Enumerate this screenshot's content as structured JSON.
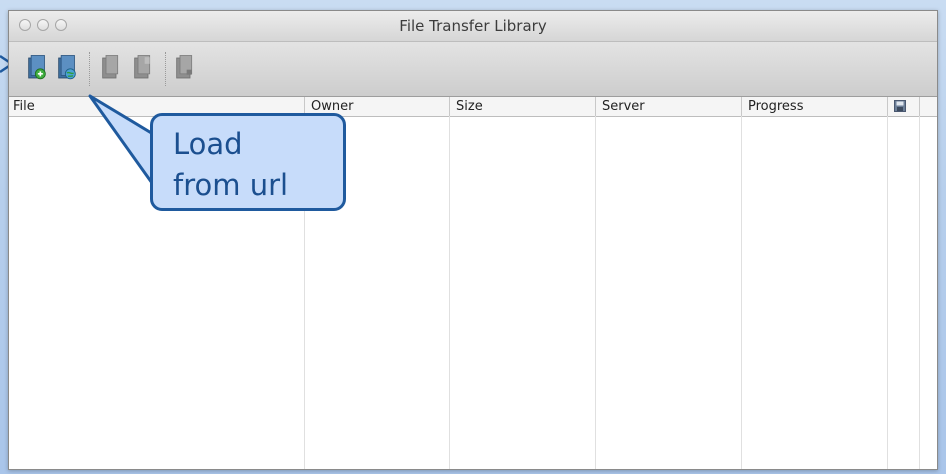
{
  "window": {
    "title": "File Transfer Library",
    "traffic_lights": [
      "close",
      "minimize",
      "zoom"
    ]
  },
  "toolbar": {
    "buttons": [
      {
        "icon": "add-file-icon",
        "enabled": true
      },
      {
        "icon": "load-from-url-icon",
        "enabled": true
      },
      {
        "icon": "file-action-icon",
        "enabled": false
      },
      {
        "icon": "file-action-icon",
        "enabled": false
      },
      {
        "icon": "file-action-icon",
        "enabled": false
      }
    ]
  },
  "table": {
    "columns": [
      "File",
      "Owner",
      "Size",
      "Server",
      "Progress"
    ],
    "save_column_icon": "save-icon",
    "rows": []
  },
  "callout": {
    "line1": "Load",
    "line2": "from url"
  },
  "colors": {
    "callout_fill": "#c7dcfa",
    "callout_border": "#1f5a9e",
    "callout_text": "#1b4f8f",
    "background": "#b7cfec"
  }
}
